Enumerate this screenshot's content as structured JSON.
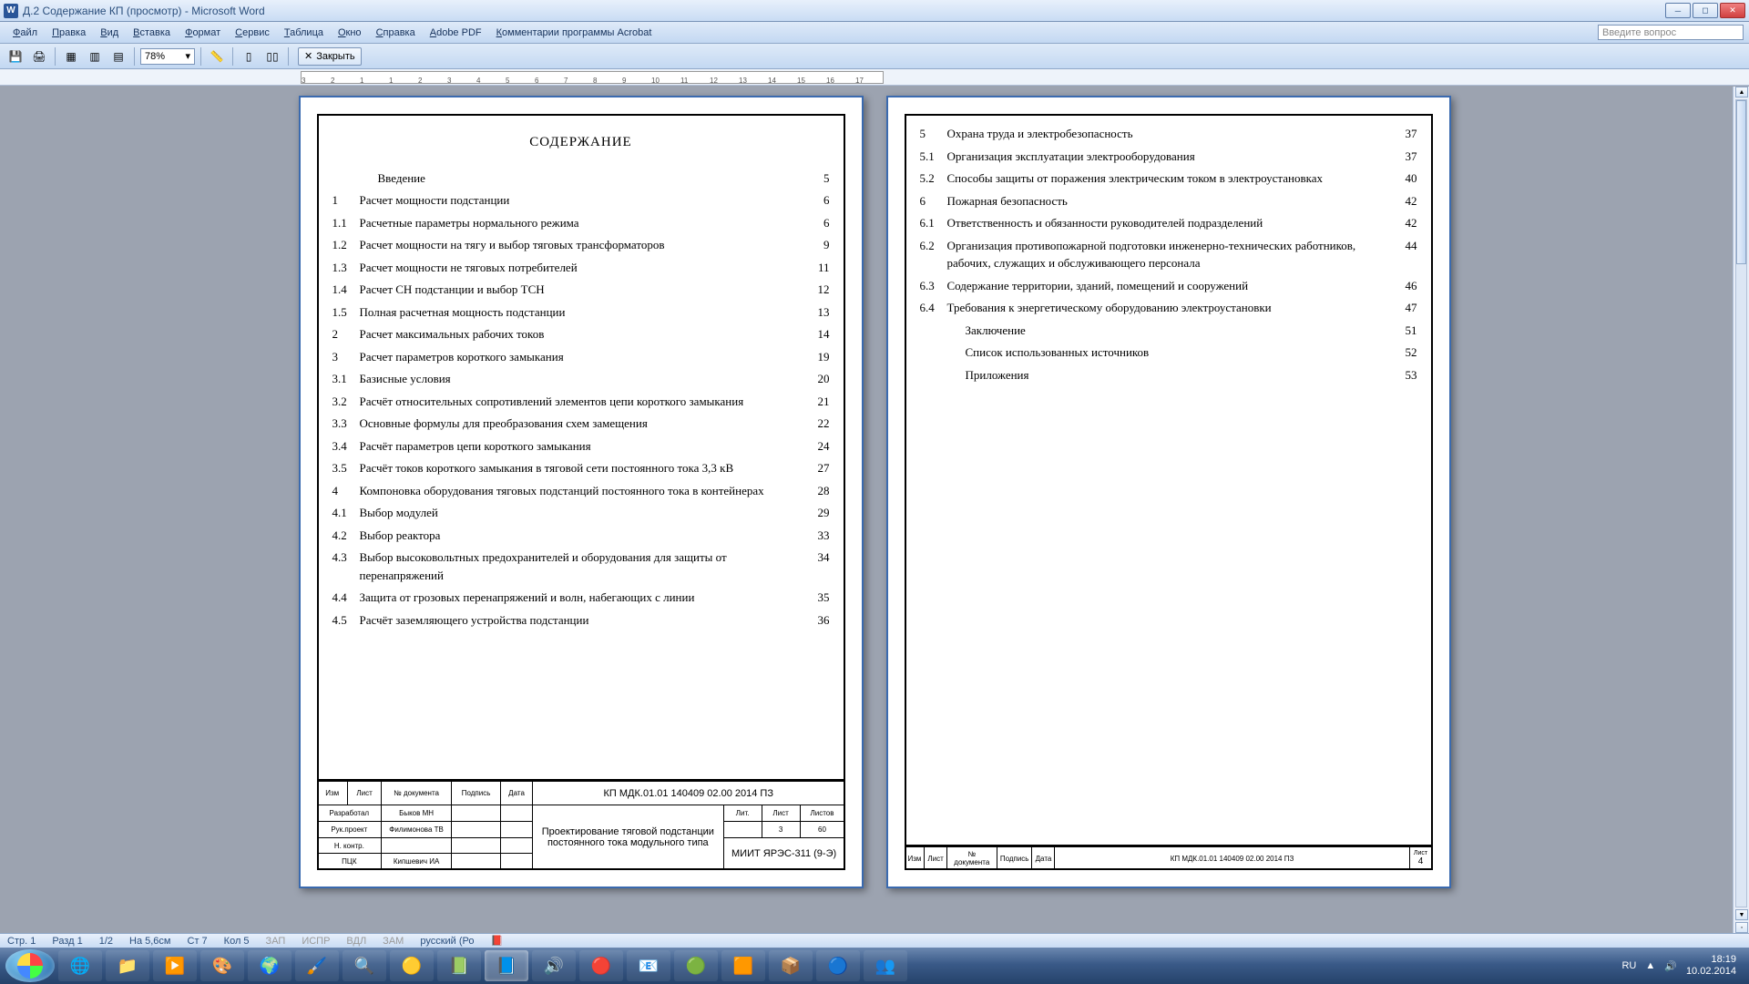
{
  "window": {
    "title": "Д.2 Содержание КП (просмотр) - Microsoft Word",
    "question_placeholder": "Введите вопрос"
  },
  "menu": [
    "Файл",
    "Правка",
    "Вид",
    "Вставка",
    "Формат",
    "Сервис",
    "Таблица",
    "Окно",
    "Справка",
    "Adobe PDF",
    "Комментарии программы Acrobat"
  ],
  "toolbar": {
    "zoom": "78%",
    "close_label": "Закрыть"
  },
  "ruler": [
    "3",
    "2",
    "1",
    "1",
    "2",
    "3",
    "4",
    "5",
    "6",
    "7",
    "8",
    "9",
    "10",
    "11",
    "12",
    "13",
    "14",
    "15",
    "16",
    "17"
  ],
  "status": {
    "page": "Стр. 1",
    "section": "Разд 1",
    "pages": "1/2",
    "at": "На 5,6см",
    "line": "Ст 7",
    "col": "Кол 5",
    "modes": [
      "ЗАП",
      "ИСПР",
      "ВДЛ",
      "ЗАМ"
    ],
    "lang": "русский (Ро"
  },
  "tray": {
    "lang": "RU",
    "time": "18:19",
    "date": "10.02.2014"
  },
  "doc": {
    "title": "СОДЕРЖАНИЕ",
    "page1": [
      {
        "n": "",
        "t": "Введение",
        "p": "5"
      },
      {
        "n": "1",
        "t": "Расчет мощности подстанции",
        "p": "6"
      },
      {
        "n": "1.1",
        "t": "Расчетные параметры нормального режима",
        "p": "6"
      },
      {
        "n": "1.2",
        "t": "Расчет  мощности  на тягу и выбор тяговых трансформаторов",
        "p": "9"
      },
      {
        "n": "1.3",
        "t": "Расчет мощности не тяговых потребителей",
        "p": "11"
      },
      {
        "n": "1.4",
        "t": "Расчет СН подстанции и выбор ТСН",
        "p": "12"
      },
      {
        "n": "1.5",
        "t": "Полная расчетная мощность подстанции",
        "p": "13"
      },
      {
        "n": "2",
        "t": "Расчет максимальных рабочих токов",
        "p": "14"
      },
      {
        "n": "3",
        "t": "Расчет параметров короткого замыкания",
        "p": "19"
      },
      {
        "n": "3.1",
        "t": "Базисные условия",
        "p": "20"
      },
      {
        "n": "3.2",
        "t": "Расчёт относительных сопротивлений элементов цепи короткого замыкания",
        "p": "21"
      },
      {
        "n": "3.3",
        "t": "Основные формулы для преобразования схем замещения",
        "p": "22"
      },
      {
        "n": "3.4",
        "t": "Расчёт параметров цепи короткого замыкания",
        "p": "24"
      },
      {
        "n": "3.5",
        "t": "Расчёт токов короткого замыкания в тяговой сети постоянного тока 3,3 кВ",
        "p": "27"
      },
      {
        "n": "4",
        "t": "Компоновка оборудования тяговых подстанций постоянного тока в контейнерах",
        "p": "28"
      },
      {
        "n": "4.1",
        "t": "Выбор модулей",
        "p": "29"
      },
      {
        "n": "4.2",
        "t": "Выбор реактора",
        "p": "33"
      },
      {
        "n": "4.3",
        "t": "Выбор высоковольтных предохранителей и оборудования для защиты от перенапряжений",
        "p": "34"
      },
      {
        "n": "4.4",
        "t": "Защита от грозовых перенапряжений и волн, набегающих с линии",
        "p": "35"
      },
      {
        "n": "4.5",
        "t": "Расчёт заземляющего устройства подстанции",
        "p": "36"
      }
    ],
    "page2": [
      {
        "n": "5",
        "t": "Охрана труда и электробезопасность",
        "p": "37"
      },
      {
        "n": "5.1",
        "t": "Организация эксплуатации электрооборудования",
        "p": "37"
      },
      {
        "n": "5.2",
        "t": "Способы защиты от поражения электрическим током в электроустановках",
        "p": "40"
      },
      {
        "n": "6",
        "t": "Пожарная безопасность",
        "p": "42"
      },
      {
        "n": "6.1",
        "t": "Ответственность и обязанности руководителей подразделений",
        "p": "42"
      },
      {
        "n": "6.2",
        "t": "Организация противопожарной подготовки инженерно-технических работников, рабочих, служащих и обслуживающего персонала",
        "p": "44"
      },
      {
        "n": "6.3",
        "t": "Содержание территории, зданий, помещений и сооружений",
        "p": "46"
      },
      {
        "n": "6.4",
        "t": "Требования к энергетическому оборудованию электроустановки",
        "p": "47"
      },
      {
        "n": "",
        "t": "Заключение",
        "p": "51"
      },
      {
        "n": "",
        "t": "Список использованных источников",
        "p": "52"
      },
      {
        "n": "",
        "t": "Приложения",
        "p": "53"
      }
    ],
    "block1": {
      "code": "КП МДК.01.01 140409 02.00 2014 ПЗ",
      "project_title": "Проектирование тяговой подстанции постоянного тока модульного типа",
      "group": "МИИТ ЯРЭС-311 (9-Э)",
      "hdr": [
        "Изм",
        "Лист",
        "№ документа",
        "Подпись",
        "Дата"
      ],
      "rows": [
        [
          "Разработал",
          "Быков МН"
        ],
        [
          "Рук.проект",
          "Филимонова ТВ"
        ],
        [
          "Н. контр.",
          ""
        ],
        [
          "ПЦК",
          "Кипшевич ИА"
        ]
      ],
      "sheet_hdr": [
        "Лит.",
        "Лист",
        "Листов"
      ],
      "sheet_vals": [
        "",
        "3",
        "60"
      ]
    },
    "block2": {
      "code": "КП МДК.01.01 140409 02.00 2014 ПЗ",
      "hdr": [
        "Изм",
        "Лист",
        "№ документа",
        "Подпись",
        "Дата"
      ],
      "sheet_label": "Лист",
      "sheet_num": "4"
    }
  }
}
